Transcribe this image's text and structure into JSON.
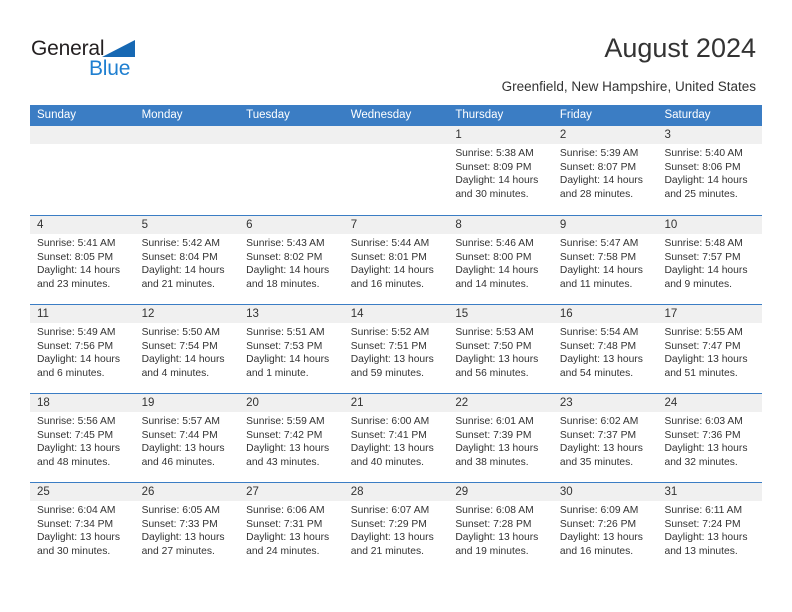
{
  "brand": {
    "name_part1": "General",
    "name_part2": "Blue",
    "color_dark": "#231f20",
    "color_blue": "#1f7fd0",
    "triangle_icon": "triangle-icon"
  },
  "header": {
    "title": "August 2024",
    "subtitle": "Greenfield, New Hampshire, United States"
  },
  "theme": {
    "header_blue": "#3b7dc4",
    "day_band_gray": "#f0f0f0",
    "text": "#333333"
  },
  "calendar": {
    "weekdays": [
      "Sunday",
      "Monday",
      "Tuesday",
      "Wednesday",
      "Thursday",
      "Friday",
      "Saturday"
    ],
    "weeks": [
      [
        {
          "day": "",
          "lines": []
        },
        {
          "day": "",
          "lines": []
        },
        {
          "day": "",
          "lines": []
        },
        {
          "day": "",
          "lines": []
        },
        {
          "day": "1",
          "lines": [
            "Sunrise: 5:38 AM",
            "Sunset: 8:09 PM",
            "Daylight: 14 hours",
            "and 30 minutes."
          ]
        },
        {
          "day": "2",
          "lines": [
            "Sunrise: 5:39 AM",
            "Sunset: 8:07 PM",
            "Daylight: 14 hours",
            "and 28 minutes."
          ]
        },
        {
          "day": "3",
          "lines": [
            "Sunrise: 5:40 AM",
            "Sunset: 8:06 PM",
            "Daylight: 14 hours",
            "and 25 minutes."
          ]
        }
      ],
      [
        {
          "day": "4",
          "lines": [
            "Sunrise: 5:41 AM",
            "Sunset: 8:05 PM",
            "Daylight: 14 hours",
            "and 23 minutes."
          ]
        },
        {
          "day": "5",
          "lines": [
            "Sunrise: 5:42 AM",
            "Sunset: 8:04 PM",
            "Daylight: 14 hours",
            "and 21 minutes."
          ]
        },
        {
          "day": "6",
          "lines": [
            "Sunrise: 5:43 AM",
            "Sunset: 8:02 PM",
            "Daylight: 14 hours",
            "and 18 minutes."
          ]
        },
        {
          "day": "7",
          "lines": [
            "Sunrise: 5:44 AM",
            "Sunset: 8:01 PM",
            "Daylight: 14 hours",
            "and 16 minutes."
          ]
        },
        {
          "day": "8",
          "lines": [
            "Sunrise: 5:46 AM",
            "Sunset: 8:00 PM",
            "Daylight: 14 hours",
            "and 14 minutes."
          ]
        },
        {
          "day": "9",
          "lines": [
            "Sunrise: 5:47 AM",
            "Sunset: 7:58 PM",
            "Daylight: 14 hours",
            "and 11 minutes."
          ]
        },
        {
          "day": "10",
          "lines": [
            "Sunrise: 5:48 AM",
            "Sunset: 7:57 PM",
            "Daylight: 14 hours",
            "and 9 minutes."
          ]
        }
      ],
      [
        {
          "day": "11",
          "lines": [
            "Sunrise: 5:49 AM",
            "Sunset: 7:56 PM",
            "Daylight: 14 hours",
            "and 6 minutes."
          ]
        },
        {
          "day": "12",
          "lines": [
            "Sunrise: 5:50 AM",
            "Sunset: 7:54 PM",
            "Daylight: 14 hours",
            "and 4 minutes."
          ]
        },
        {
          "day": "13",
          "lines": [
            "Sunrise: 5:51 AM",
            "Sunset: 7:53 PM",
            "Daylight: 14 hours",
            "and 1 minute."
          ]
        },
        {
          "day": "14",
          "lines": [
            "Sunrise: 5:52 AM",
            "Sunset: 7:51 PM",
            "Daylight: 13 hours",
            "and 59 minutes."
          ]
        },
        {
          "day": "15",
          "lines": [
            "Sunrise: 5:53 AM",
            "Sunset: 7:50 PM",
            "Daylight: 13 hours",
            "and 56 minutes."
          ]
        },
        {
          "day": "16",
          "lines": [
            "Sunrise: 5:54 AM",
            "Sunset: 7:48 PM",
            "Daylight: 13 hours",
            "and 54 minutes."
          ]
        },
        {
          "day": "17",
          "lines": [
            "Sunrise: 5:55 AM",
            "Sunset: 7:47 PM",
            "Daylight: 13 hours",
            "and 51 minutes."
          ]
        }
      ],
      [
        {
          "day": "18",
          "lines": [
            "Sunrise: 5:56 AM",
            "Sunset: 7:45 PM",
            "Daylight: 13 hours",
            "and 48 minutes."
          ]
        },
        {
          "day": "19",
          "lines": [
            "Sunrise: 5:57 AM",
            "Sunset: 7:44 PM",
            "Daylight: 13 hours",
            "and 46 minutes."
          ]
        },
        {
          "day": "20",
          "lines": [
            "Sunrise: 5:59 AM",
            "Sunset: 7:42 PM",
            "Daylight: 13 hours",
            "and 43 minutes."
          ]
        },
        {
          "day": "21",
          "lines": [
            "Sunrise: 6:00 AM",
            "Sunset: 7:41 PM",
            "Daylight: 13 hours",
            "and 40 minutes."
          ]
        },
        {
          "day": "22",
          "lines": [
            "Sunrise: 6:01 AM",
            "Sunset: 7:39 PM",
            "Daylight: 13 hours",
            "and 38 minutes."
          ]
        },
        {
          "day": "23",
          "lines": [
            "Sunrise: 6:02 AM",
            "Sunset: 7:37 PM",
            "Daylight: 13 hours",
            "and 35 minutes."
          ]
        },
        {
          "day": "24",
          "lines": [
            "Sunrise: 6:03 AM",
            "Sunset: 7:36 PM",
            "Daylight: 13 hours",
            "and 32 minutes."
          ]
        }
      ],
      [
        {
          "day": "25",
          "lines": [
            "Sunrise: 6:04 AM",
            "Sunset: 7:34 PM",
            "Daylight: 13 hours",
            "and 30 minutes."
          ]
        },
        {
          "day": "26",
          "lines": [
            "Sunrise: 6:05 AM",
            "Sunset: 7:33 PM",
            "Daylight: 13 hours",
            "and 27 minutes."
          ]
        },
        {
          "day": "27",
          "lines": [
            "Sunrise: 6:06 AM",
            "Sunset: 7:31 PM",
            "Daylight: 13 hours",
            "and 24 minutes."
          ]
        },
        {
          "day": "28",
          "lines": [
            "Sunrise: 6:07 AM",
            "Sunset: 7:29 PM",
            "Daylight: 13 hours",
            "and 21 minutes."
          ]
        },
        {
          "day": "29",
          "lines": [
            "Sunrise: 6:08 AM",
            "Sunset: 7:28 PM",
            "Daylight: 13 hours",
            "and 19 minutes."
          ]
        },
        {
          "day": "30",
          "lines": [
            "Sunrise: 6:09 AM",
            "Sunset: 7:26 PM",
            "Daylight: 13 hours",
            "and 16 minutes."
          ]
        },
        {
          "day": "31",
          "lines": [
            "Sunrise: 6:11 AM",
            "Sunset: 7:24 PM",
            "Daylight: 13 hours",
            "and 13 minutes."
          ]
        }
      ]
    ]
  }
}
